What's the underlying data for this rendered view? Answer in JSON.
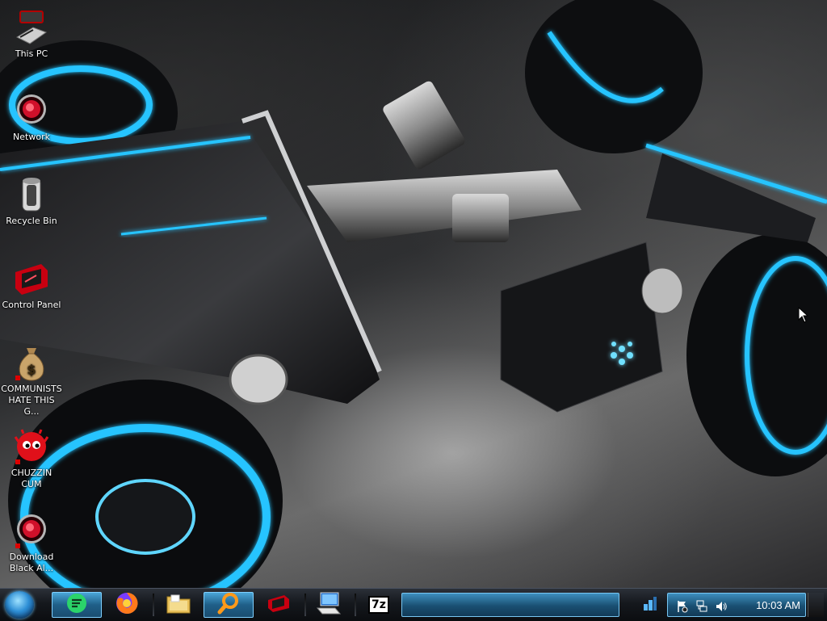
{
  "desktop": {
    "icons": [
      {
        "name": "this-pc",
        "label": "This PC",
        "icon": "computer-icon"
      },
      {
        "name": "network",
        "label": "Network",
        "icon": "network-globe-icon"
      },
      {
        "name": "recycle-bin",
        "label": "Recycle Bin",
        "icon": "trash-can-icon"
      },
      {
        "name": "control-panel",
        "label": "Control Panel",
        "icon": "control-panel-icon"
      },
      {
        "name": "communists-hate-this",
        "label": "COMMUNISTS HATE THIS G...",
        "icon": "money-bag-icon"
      },
      {
        "name": "chuzzin-cum",
        "label": "CHUZZIN CUM",
        "icon": "red-creature-icon"
      },
      {
        "name": "download-black",
        "label": "Download Black Al...",
        "icon": "red-orb-icon"
      }
    ]
  },
  "taskbar": {
    "start_icon": "start-orb-icon",
    "pinned": [
      {
        "name": "chat-app",
        "icon": "chat-bubble-icon",
        "active": true
      },
      {
        "name": "firefox",
        "icon": "firefox-icon",
        "active": false
      },
      {
        "name": "file-explorer",
        "icon": "folder-icon",
        "active": false
      },
      {
        "name": "search",
        "icon": "magnifier-icon",
        "active": true
      },
      {
        "name": "control-panel",
        "icon": "control-panel-icon",
        "active": false
      },
      {
        "name": "remote-desktop",
        "icon": "monitor-keyboard-icon",
        "active": false
      },
      {
        "name": "7zip",
        "icon": "7zip-icon",
        "label": "7z",
        "active": false
      }
    ],
    "tray": {
      "icons": [
        "action-center-flag-icon",
        "network-tray-icon",
        "volume-icon"
      ],
      "clock": "10:03 AM"
    }
  },
  "colors": {
    "accent": "#29c8ff",
    "taskbar_highlight": "#3d8fbf"
  }
}
